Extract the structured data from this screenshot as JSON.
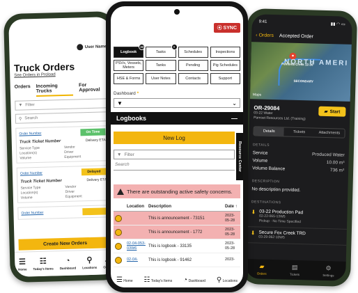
{
  "left_phone": {
    "user_label": "User Name",
    "title": "Truck Orders",
    "link": "See Orders in Proload",
    "tabs": [
      "Orders",
      "Incoming Trucks",
      "For Approval"
    ],
    "filter_placeholder": "Filter",
    "search_placeholder": "Search",
    "cards": [
      {
        "order_label": "Order Number",
        "status": "On Time",
        "status_color": "#5cc16b",
        "ticket": "Truck Ticket Number",
        "eta": "Delivery ETA",
        "fields": [
          "Service Type",
          "Vendor",
          "Location(s)",
          "Driver",
          "Volume",
          "Equipment"
        ]
      },
      {
        "order_label": "Order Number",
        "status": "Delayed",
        "status_color": "#f3c21b",
        "ticket": "Truck Ticket Number",
        "eta": "Delivery ETA",
        "fields": [
          "Service Type",
          "Vendor",
          "Location(s)",
          "Driver",
          "Volume",
          "Equipment"
        ]
      },
      {
        "order_label": "Order Number",
        "status": "",
        "status_color": "#f3c21b"
      }
    ],
    "create_button": "Create New Orders",
    "nav": [
      "Home",
      "Today's Items",
      "Dashboard",
      "Locations",
      "Orders"
    ]
  },
  "middle_phone": {
    "sync": "SYNC",
    "grid": [
      {
        "label": "Logbook",
        "count": "33",
        "active": true
      },
      {
        "label": "Tasks",
        "count": "0"
      },
      {
        "label": "Schedules"
      },
      {
        "label": "Inspections"
      },
      {
        "label": "PSVs, Vessels, Meters"
      },
      {
        "label": "Tanks"
      },
      {
        "label": "Pending"
      },
      {
        "label": "Pig Schedules"
      },
      {
        "label": "HSE & Forms"
      },
      {
        "label": "User Notes"
      },
      {
        "label": "Contacts"
      },
      {
        "label": "Support"
      }
    ],
    "dashboard_label": "Dashboard",
    "dashboard_marker": "*",
    "logbooks_title": "Logbooks",
    "new_log": "New Log",
    "filter_placeholder": "Filter",
    "search_placeholder": "Search",
    "side_tab": "Resource Center",
    "alert": "There are outstanding active safety concerns.",
    "table": {
      "headers": [
        "Location",
        "Description",
        "Date"
      ],
      "rows": [
        {
          "location": "",
          "description": "This is announcement - 73151",
          "date": "2023-05-28",
          "highlight": true
        },
        {
          "location": "",
          "description": "This is announcement - 1772",
          "date": "2023-05-28",
          "highlight": true
        },
        {
          "location": "02-04-053-03W6",
          "description": "This is logbook - 33135",
          "date": "2023-05-28",
          "highlight": false
        },
        {
          "location": "02-04-",
          "description": "This is logbook - 91462",
          "date": "2023-",
          "highlight": false
        }
      ]
    },
    "nav": [
      "Home",
      "Today's Items",
      "Dashboard",
      "Locations"
    ]
  },
  "right_phone": {
    "time": "9:41",
    "back": "Orders",
    "title": "Accepted Order",
    "map_labels": [
      "Pembina Creek 12-36",
      "SECONDARY"
    ],
    "map_region": "NORTH AMERI",
    "maps_credit": "Maps",
    "order_id": "OR-29084",
    "order_sub": "03-22 Water",
    "order_company": "Pamset Resources Ltd. (Training)",
    "start": "Start",
    "tabs": [
      "Details",
      "Tickets",
      "Attachments"
    ],
    "details_title": "DETAILS",
    "details": [
      {
        "k": "Service",
        "v": "Produced Water"
      },
      {
        "k": "Volume",
        "v": "10.00 m³"
      },
      {
        "k": "Volume Balance",
        "v": "736 m³"
      }
    ],
    "description_title": "DESCRIPTION",
    "description": "No description provided.",
    "destinations_title": "DESTINATIONS",
    "destinations": [
      {
        "name": "03-22 Production Pad",
        "code": "02-22-065-13W5",
        "note": "Pickup · No Time Specified"
      },
      {
        "name": "Secure Fox Creek TRD",
        "code": "03-29-062-10W5",
        "note": ""
      }
    ],
    "nav": [
      "Orders",
      "Tickets",
      "Settings"
    ]
  }
}
